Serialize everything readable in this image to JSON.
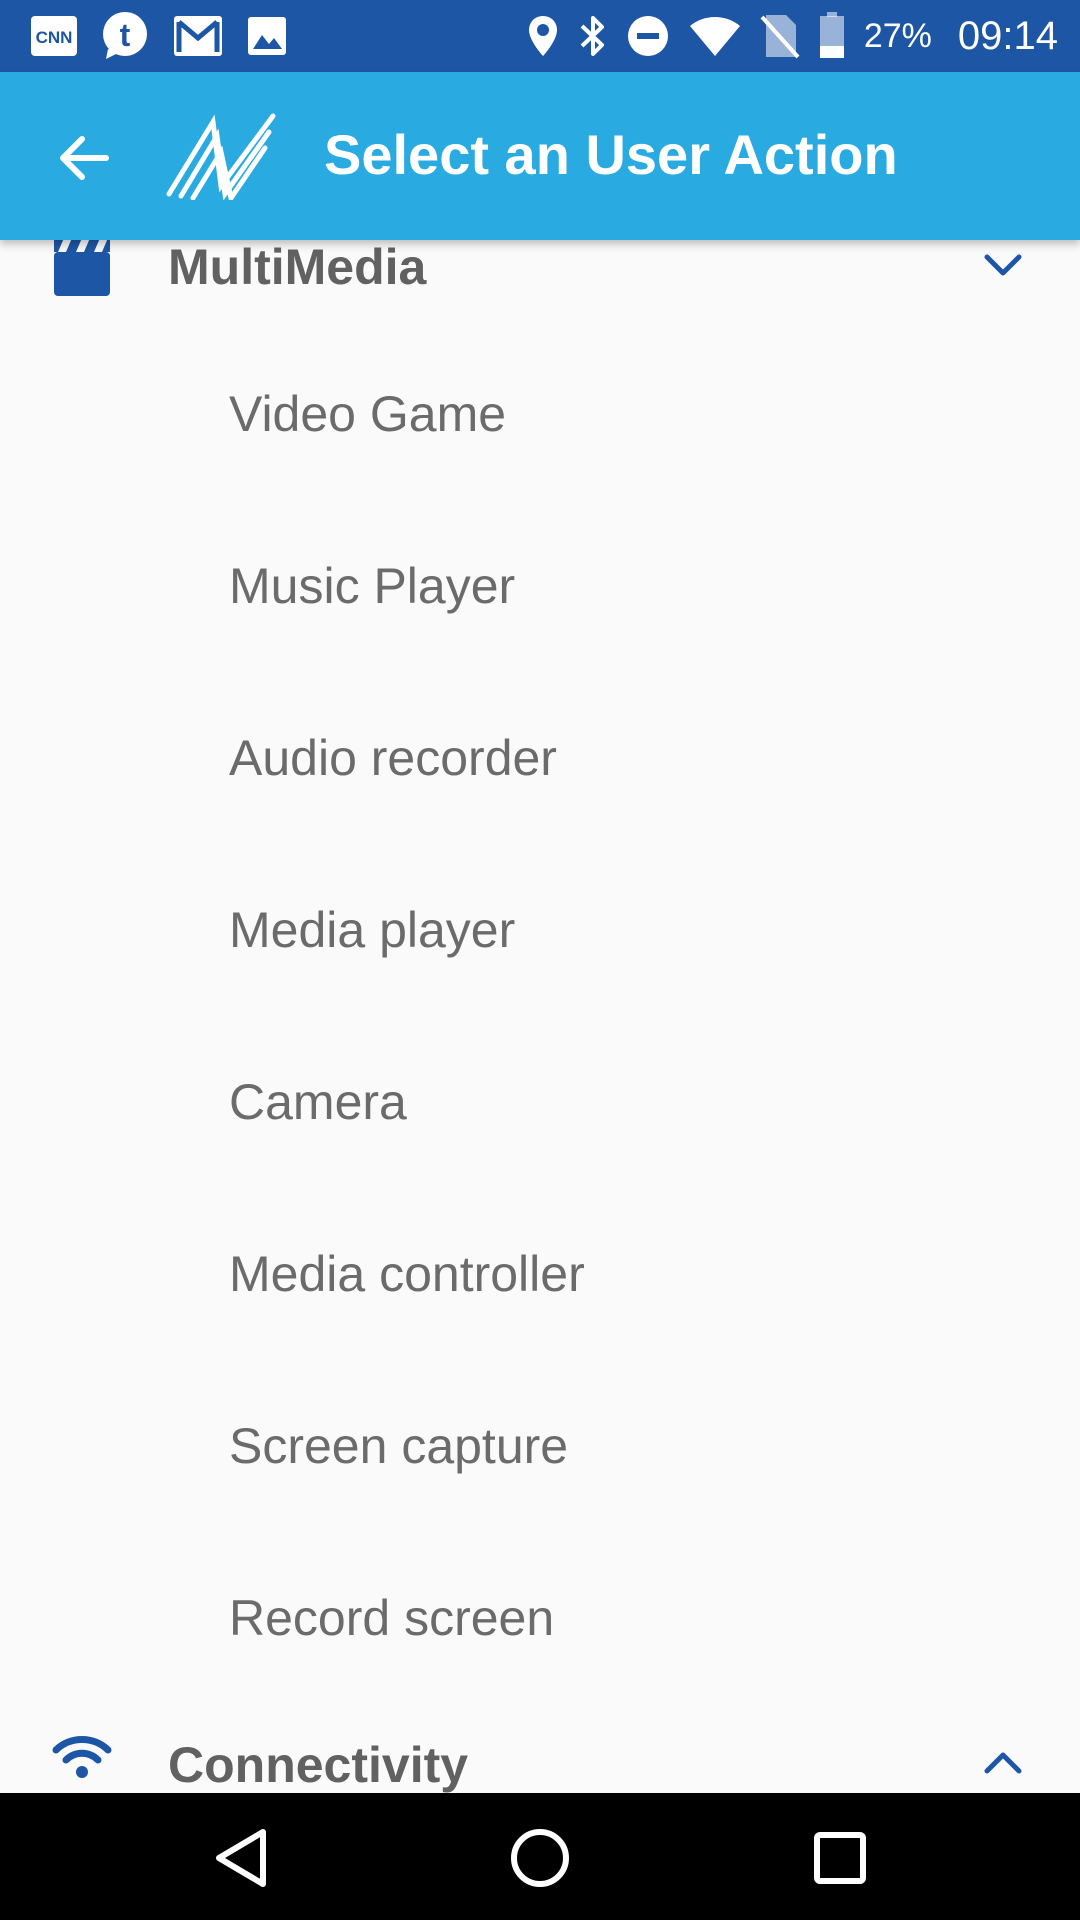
{
  "status_bar": {
    "notification_icons": [
      "cnn-icon",
      "tumblr-icon",
      "gmail-icon",
      "image-icon"
    ],
    "system_icons": [
      "location-icon",
      "bluetooth-icon",
      "do-not-disturb-icon",
      "wifi-icon",
      "no-sim-icon",
      "battery-icon"
    ],
    "battery_percent": "27%",
    "time": "09:14"
  },
  "app_bar": {
    "title": "Select an User Action",
    "back_icon": "arrow-left-icon",
    "logo_icon": "app-logo-icon"
  },
  "sections": [
    {
      "title": "MultiMedia",
      "icon": "clapperboard-icon",
      "chevron": "chevron-down-icon",
      "items": [
        "Video Game",
        "Music Player",
        "Audio recorder",
        "Media player",
        "Camera",
        "Media controller",
        "Screen capture",
        "Record screen"
      ]
    },
    {
      "title": "Connectivity",
      "icon": "wifi-icon",
      "chevron": "chevron-up-icon",
      "items": []
    }
  ],
  "nav_bar": {
    "back": "nav-back-icon",
    "home": "nav-home-icon",
    "recents": "nav-recents-icon"
  },
  "colors": {
    "status_bar": "#1e56a6",
    "app_bar": "#29abe2",
    "accent_icon": "#1e56a6",
    "section_text": "#616161",
    "item_text": "#6b6b6b",
    "background": "#fafafa",
    "nav_bar": "#000000"
  }
}
